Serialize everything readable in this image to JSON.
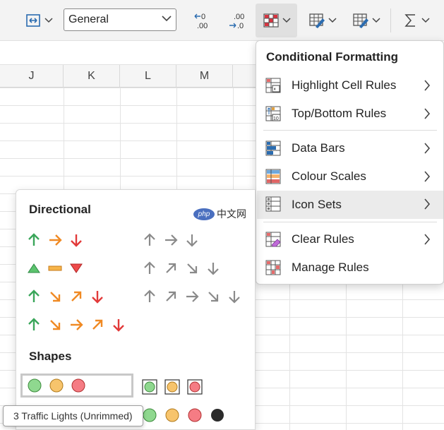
{
  "toolbar": {
    "number_format": "General",
    "decrease_decimal_label": "←.0\n.00",
    "increase_decimal_label": ".00\n→.0"
  },
  "sheet": {
    "columns": [
      "J",
      "K",
      "L",
      "M"
    ]
  },
  "cf_menu": {
    "title": "Conditional Formatting",
    "items": [
      {
        "label": "Highlight Cell Rules",
        "icon": "highlight-cell-rules-icon"
      },
      {
        "label": "Top/Bottom Rules",
        "icon": "top-bottom-rules-icon"
      },
      {
        "label": "Data Bars",
        "icon": "data-bars-icon"
      },
      {
        "label": "Colour Scales",
        "icon": "colour-scales-icon"
      },
      {
        "label": "Icon Sets",
        "icon": "icon-sets-icon"
      },
      {
        "label": "Clear Rules",
        "icon": "clear-rules-icon"
      },
      {
        "label": "Manage Rules",
        "icon": "manage-rules-icon"
      }
    ]
  },
  "icon_sets": {
    "directional_heading": "Directional",
    "shapes_heading": "Shapes"
  },
  "watermark": {
    "logo": "php",
    "text": "中文网"
  },
  "tooltip": "3 Traffic Lights (Unrimmed)",
  "colors": {
    "green": "#3aa65a",
    "orange": "#f08a24",
    "red": "#e23a3a",
    "gray": "#8a8a8a",
    "light_green": "#8fd88f",
    "light_orange": "#f7c46c",
    "light_red": "#f57c84"
  }
}
